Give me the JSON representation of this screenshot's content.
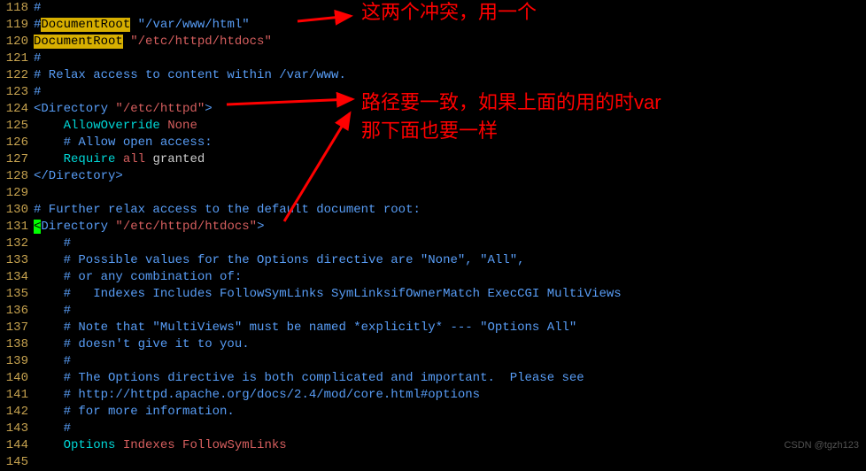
{
  "lines": [
    {
      "num": "118",
      "segments": [
        {
          "text": "#",
          "cls": "comment"
        }
      ]
    },
    {
      "num": "119",
      "segments": [
        {
          "text": "#",
          "cls": "comment"
        },
        {
          "text": "DocumentRoot",
          "cls": "highlight-yellow"
        },
        {
          "text": " ",
          "cls": "comment"
        },
        {
          "text": "\"/var/www/html\"",
          "cls": "comment"
        }
      ]
    },
    {
      "num": "120",
      "segments": [
        {
          "text": "DocumentRoot",
          "cls": "highlight-yellow"
        },
        {
          "text": " ",
          "cls": ""
        },
        {
          "text": "\"/etc/httpd/htdocs\"",
          "cls": "string"
        }
      ]
    },
    {
      "num": "121",
      "segments": [
        {
          "text": "#",
          "cls": "comment"
        }
      ]
    },
    {
      "num": "122",
      "segments": [
        {
          "text": "# Relax access to content within /var/www.",
          "cls": "comment"
        }
      ]
    },
    {
      "num": "123",
      "segments": [
        {
          "text": "#",
          "cls": "comment"
        }
      ]
    },
    {
      "num": "124",
      "segments": [
        {
          "text": "<Directory ",
          "cls": "angle"
        },
        {
          "text": "\"/etc/httpd\"",
          "cls": "string"
        },
        {
          "text": ">",
          "cls": "angle"
        }
      ]
    },
    {
      "num": "125",
      "segments": [
        {
          "text": "    ",
          "cls": ""
        },
        {
          "text": "AllowOverride",
          "cls": "directive-cyan"
        },
        {
          "text": " ",
          "cls": ""
        },
        {
          "text": "None",
          "cls": "value-red"
        }
      ]
    },
    {
      "num": "126",
      "segments": [
        {
          "text": "    # Allow open access:",
          "cls": "comment"
        }
      ]
    },
    {
      "num": "127",
      "segments": [
        {
          "text": "    ",
          "cls": ""
        },
        {
          "text": "Require",
          "cls": "directive-cyan"
        },
        {
          "text": " ",
          "cls": ""
        },
        {
          "text": "all",
          "cls": "value-red"
        },
        {
          "text": " ",
          "cls": ""
        },
        {
          "text": "granted",
          "cls": "value-white"
        }
      ]
    },
    {
      "num": "128",
      "segments": [
        {
          "text": "</Directory>",
          "cls": "angle"
        }
      ]
    },
    {
      "num": "129",
      "segments": []
    },
    {
      "num": "130",
      "segments": [
        {
          "text": "# Further relax access to the default document root:",
          "cls": "comment"
        }
      ]
    },
    {
      "num": "131",
      "segments": [
        {
          "text": "<",
          "cls": "cursor-green"
        },
        {
          "text": "Directory ",
          "cls": "angle"
        },
        {
          "text": "\"/etc/httpd/htdocs\"",
          "cls": "string"
        },
        {
          "text": ">",
          "cls": "angle"
        }
      ]
    },
    {
      "num": "132",
      "segments": [
        {
          "text": "    #",
          "cls": "comment"
        }
      ]
    },
    {
      "num": "133",
      "segments": [
        {
          "text": "    # Possible values for the Options directive are \"None\", \"All\",",
          "cls": "comment"
        }
      ]
    },
    {
      "num": "134",
      "segments": [
        {
          "text": "    # or any combination of:",
          "cls": "comment"
        }
      ]
    },
    {
      "num": "135",
      "segments": [
        {
          "text": "    #   Indexes Includes FollowSymLinks SymLinksifOwnerMatch ExecCGI MultiViews",
          "cls": "comment"
        }
      ]
    },
    {
      "num": "136",
      "segments": [
        {
          "text": "    #",
          "cls": "comment"
        }
      ]
    },
    {
      "num": "137",
      "segments": [
        {
          "text": "    # Note that \"MultiViews\" must be named *explicitly* --- \"Options All\"",
          "cls": "comment"
        }
      ]
    },
    {
      "num": "138",
      "segments": [
        {
          "text": "    # doesn't give it to you.",
          "cls": "comment"
        }
      ]
    },
    {
      "num": "139",
      "segments": [
        {
          "text": "    #",
          "cls": "comment"
        }
      ]
    },
    {
      "num": "140",
      "segments": [
        {
          "text": "    # The Options directive is both complicated and important.  Please see",
          "cls": "comment"
        }
      ]
    },
    {
      "num": "141",
      "segments": [
        {
          "text": "    # http://httpd.apache.org/docs/2.4/mod/core.html#options",
          "cls": "comment"
        }
      ]
    },
    {
      "num": "142",
      "segments": [
        {
          "text": "    # for more information.",
          "cls": "comment"
        }
      ]
    },
    {
      "num": "143",
      "segments": [
        {
          "text": "    #",
          "cls": "comment"
        }
      ]
    },
    {
      "num": "144",
      "segments": [
        {
          "text": "    ",
          "cls": ""
        },
        {
          "text": "Options",
          "cls": "directive-cyan"
        },
        {
          "text": " ",
          "cls": ""
        },
        {
          "text": "Indexes FollowSymLinks",
          "cls": "value-red"
        }
      ]
    },
    {
      "num": "145",
      "segments": []
    }
  ],
  "annotations": {
    "anno1": "这两个冲突，用一个",
    "anno2_line1": "路径要一致，如果上面的用的时var",
    "anno2_line2": "那下面也要一样"
  },
  "watermark": "CSDN @tgzh123"
}
